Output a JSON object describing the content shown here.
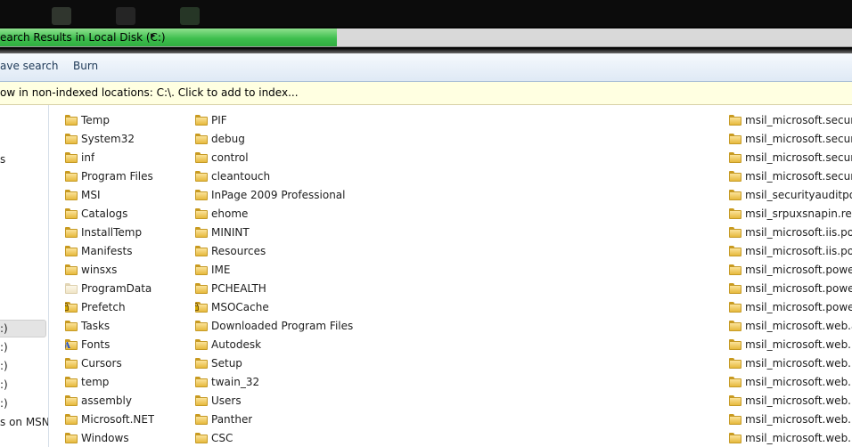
{
  "address_bar": {
    "path": "earch Results in Local Disk (C:)",
    "arrow": "▸"
  },
  "toolbar": {
    "save_search": "ave search",
    "burn": "Burn"
  },
  "info_bar": {
    "message": "ow in non-indexed locations: C:\\. Click to add to index..."
  },
  "nav_pane": {
    "items": [
      {
        "label": "s"
      },
      {
        "label": ":)"
      },
      {
        "label": ":)"
      },
      {
        "label": ":)"
      },
      {
        "label": ":)"
      },
      {
        "label": ":)"
      },
      {
        "label": "s on MSN"
      }
    ]
  },
  "columns": [
    {
      "items": [
        {
          "name": "Temp",
          "icon": "folder-icon"
        },
        {
          "name": "System32",
          "icon": "folder-icon"
        },
        {
          "name": "inf",
          "icon": "folder-icon"
        },
        {
          "name": "Program Files",
          "icon": "folder-icon"
        },
        {
          "name": "MSI",
          "icon": "folder-icon"
        },
        {
          "name": "Catalogs",
          "icon": "folder-icon"
        },
        {
          "name": "InstallTemp",
          "icon": "folder-icon"
        },
        {
          "name": "Manifests",
          "icon": "folder-icon"
        },
        {
          "name": "winsxs",
          "icon": "folder-icon"
        },
        {
          "name": "ProgramData",
          "icon": "hidden-folder-icon"
        },
        {
          "name": "Prefetch",
          "icon": "locked-folder-icon"
        },
        {
          "name": "Tasks",
          "icon": "folder-icon"
        },
        {
          "name": "Fonts",
          "icon": "fonts-folder-icon"
        },
        {
          "name": "Cursors",
          "icon": "folder-icon"
        },
        {
          "name": "temp",
          "icon": "folder-icon"
        },
        {
          "name": "assembly",
          "icon": "folder-icon"
        },
        {
          "name": "Microsoft.NET",
          "icon": "folder-icon"
        },
        {
          "name": "Windows",
          "icon": "folder-icon"
        }
      ]
    },
    {
      "items": [
        {
          "name": "PIF",
          "icon": "folder-icon"
        },
        {
          "name": "debug",
          "icon": "folder-icon"
        },
        {
          "name": "control",
          "icon": "folder-icon"
        },
        {
          "name": "cleantouch",
          "icon": "folder-icon"
        },
        {
          "name": "InPage 2009 Professional",
          "icon": "folder-icon"
        },
        {
          "name": "ehome",
          "icon": "folder-icon"
        },
        {
          "name": "MININT",
          "icon": "folder-icon"
        },
        {
          "name": "Resources",
          "icon": "folder-icon"
        },
        {
          "name": "IME",
          "icon": "folder-icon"
        },
        {
          "name": "PCHEALTH",
          "icon": "folder-icon"
        },
        {
          "name": "MSOCache",
          "icon": "locked-folder-icon"
        },
        {
          "name": "Downloaded Program Files",
          "icon": "folder-icon"
        },
        {
          "name": "Autodesk",
          "icon": "folder-icon"
        },
        {
          "name": "Setup",
          "icon": "folder-icon"
        },
        {
          "name": "twain_32",
          "icon": "folder-icon"
        },
        {
          "name": "Users",
          "icon": "folder-icon"
        },
        {
          "name": "Panther",
          "icon": "folder-icon"
        },
        {
          "name": "CSC",
          "icon": "folder-icon"
        }
      ]
    },
    {
      "items": [
        {
          "name": "msil_microsoft.security",
          "icon": "folder-icon"
        },
        {
          "name": "msil_microsoft.security",
          "icon": "folder-icon"
        },
        {
          "name": "msil_microsoft.security",
          "icon": "folder-icon"
        },
        {
          "name": "msil_microsoft.security",
          "icon": "folder-icon"
        },
        {
          "name": "msil_securityauditpolic",
          "icon": "folder-icon"
        },
        {
          "name": "msil_srpuxsnapin.resou",
          "icon": "folder-icon"
        },
        {
          "name": "msil_microsoft.iis.pow",
          "icon": "folder-icon"
        },
        {
          "name": "msil_microsoft.iis.pow",
          "icon": "folder-icon"
        },
        {
          "name": "msil_microsoft.powers",
          "icon": "folder-icon"
        },
        {
          "name": "msil_microsoft.powers",
          "icon": "folder-icon"
        },
        {
          "name": "msil_microsoft.powers",
          "icon": "folder-icon"
        },
        {
          "name": "msil_microsoft.web.ad",
          "icon": "folder-icon"
        },
        {
          "name": "msil_microsoft.web.ma",
          "icon": "folder-icon"
        },
        {
          "name": "msil_microsoft.web.ma",
          "icon": "folder-icon"
        },
        {
          "name": "msil_microsoft.web.ma",
          "icon": "folder-icon"
        },
        {
          "name": "msil_microsoft.web.ma",
          "icon": "folder-icon"
        },
        {
          "name": "msil_microsoft.web.ma",
          "icon": "folder-icon"
        },
        {
          "name": "msil_microsoft.web.ma",
          "icon": "folder-icon"
        }
      ]
    }
  ]
}
